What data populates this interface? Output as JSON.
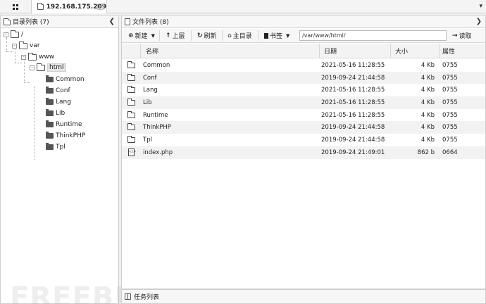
{
  "tab": {
    "label": "192.168.175.209",
    "close": "×"
  },
  "left_panel": {
    "title": "目录列表 (7)"
  },
  "tree": {
    "root": "/",
    "var": "var",
    "www": "www",
    "html": "html",
    "children": [
      "Common",
      "Conf",
      "Lang",
      "Lib",
      "Runtime",
      "ThinkPHP",
      "Tpl"
    ]
  },
  "right_panel": {
    "title": "文件列表 (8)"
  },
  "toolbar": {
    "new": "新建",
    "up": "上层",
    "refresh": "刷新",
    "home": "主目录",
    "bookmark": "书签",
    "path": "/var/www/html/",
    "read": "读取"
  },
  "columns": {
    "name": "名称",
    "date": "日期",
    "size": "大小",
    "attr": "属性"
  },
  "files": [
    {
      "type": "folder",
      "name": "Common",
      "date": "2021-05-16 11:28:55",
      "size": "4 Kb",
      "attr": "0755"
    },
    {
      "type": "folder",
      "name": "Conf",
      "date": "2019-09-24 21:44:58",
      "size": "4 Kb",
      "attr": "0755"
    },
    {
      "type": "folder",
      "name": "Lang",
      "date": "2021-05-16 11:28:55",
      "size": "4 Kb",
      "attr": "0755"
    },
    {
      "type": "folder",
      "name": "Lib",
      "date": "2021-05-16 11:28:55",
      "size": "4 Kb",
      "attr": "0755"
    },
    {
      "type": "folder",
      "name": "Runtime",
      "date": "2021-05-16 11:28:55",
      "size": "4 Kb",
      "attr": "0755"
    },
    {
      "type": "folder",
      "name": "ThinkPHP",
      "date": "2019-09-24 21:44:58",
      "size": "4 Kb",
      "attr": "0755"
    },
    {
      "type": "folder",
      "name": "Tpl",
      "date": "2019-09-24 21:44:58",
      "size": "4 Kb",
      "attr": "0755"
    },
    {
      "type": "file",
      "name": "index.php",
      "date": "2019-09-24 21:49:01",
      "size": "862 b",
      "attr": "0664"
    }
  ],
  "taskbar": {
    "title": "任务列表"
  },
  "watermark": "FREEBUF"
}
